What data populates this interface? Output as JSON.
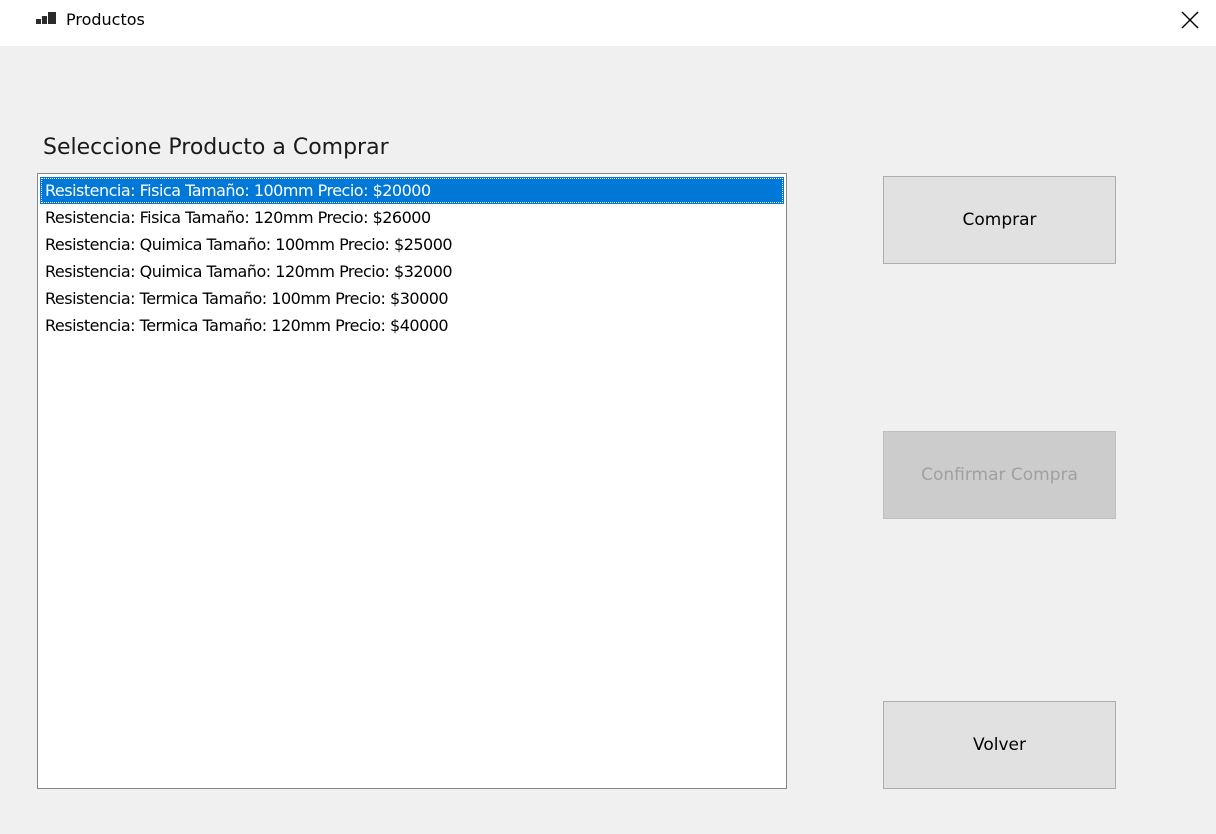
{
  "window": {
    "title": "Productos",
    "icon": "app-window-icon",
    "close_icon": "close-icon"
  },
  "main": {
    "label": "Seleccione Producto a Comprar",
    "products": [
      {
        "text": "Resistencia: Fisica Tamaño: 100mm Precio: $20000",
        "selected": true
      },
      {
        "text": "Resistencia: Fisica Tamaño: 120mm Precio: $26000",
        "selected": false
      },
      {
        "text": "Resistencia: Quimica Tamaño: 100mm Precio: $25000",
        "selected": false
      },
      {
        "text": "Resistencia: Quimica Tamaño: 120mm Precio: $32000",
        "selected": false
      },
      {
        "text": "Resistencia: Termica Tamaño: 100mm Precio: $30000",
        "selected": false
      },
      {
        "text": "Resistencia: Termica Tamaño: 120mm Precio: $40000",
        "selected": false
      }
    ]
  },
  "buttons": {
    "comprar": {
      "label": "Comprar",
      "enabled": true
    },
    "confirmar": {
      "label": "Confirmar Compra",
      "enabled": false
    },
    "volver": {
      "label": "Volver",
      "enabled": true
    }
  },
  "colors": {
    "selection": "#0078d7",
    "window_bg": "#f0f0f0",
    "button_bg": "#e1e1e1",
    "disabled_text": "#a0a0a0"
  }
}
